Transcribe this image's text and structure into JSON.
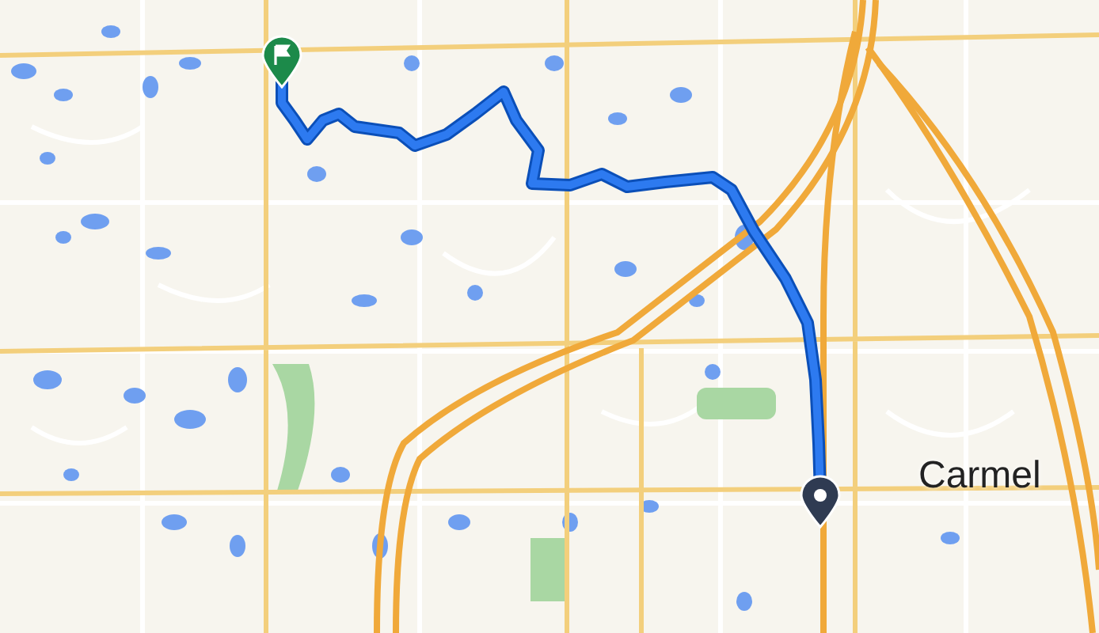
{
  "map": {
    "place_label": "Carmel"
  }
}
